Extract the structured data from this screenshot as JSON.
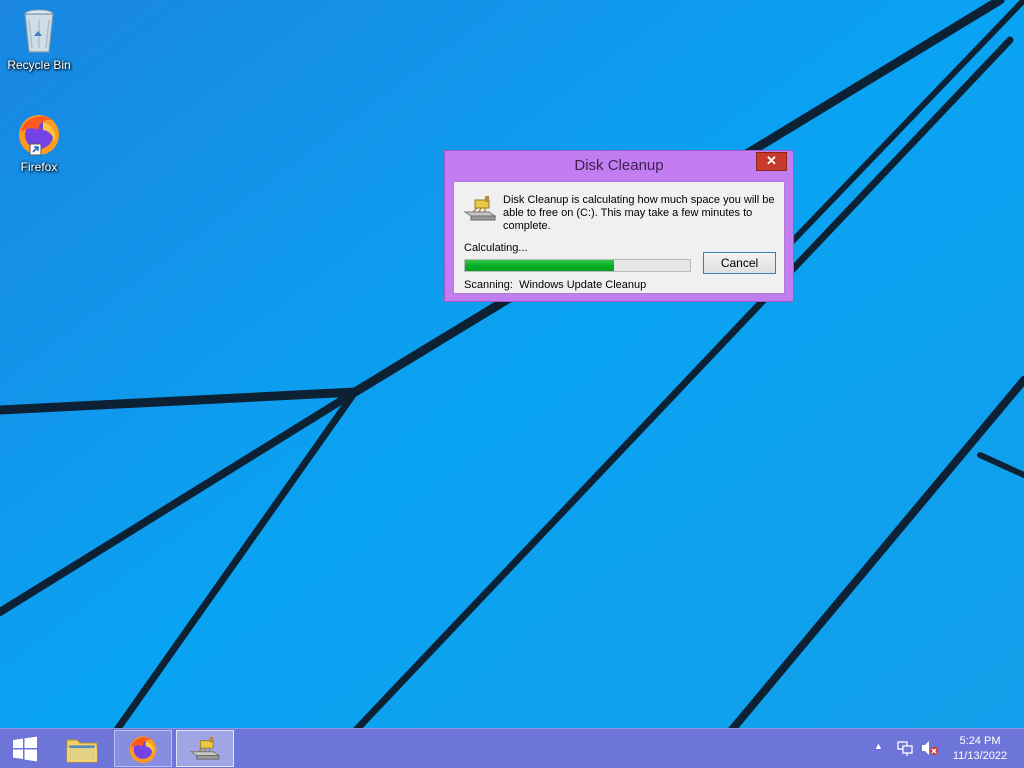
{
  "desktop": {
    "icons": [
      {
        "label": "Recycle Bin",
        "icon": "recycle-bin-icon"
      },
      {
        "label": "Firefox",
        "icon": "firefox-icon"
      }
    ]
  },
  "dialog": {
    "title": "Disk Cleanup",
    "close_glyph": "✕",
    "message": "Disk Cleanup is calculating how much space you will be able to free on  (C:). This may take a few minutes to complete.",
    "status_label": "Calculating...",
    "progress_fraction": 0.66,
    "progress_color": "#06b025",
    "cancel_label": "Cancel",
    "scanning_label": "Scanning:",
    "scanning_item": "Windows Update Cleanup"
  },
  "taskbar": {
    "items": [
      {
        "name": "start",
        "icon": "windows-logo-icon"
      },
      {
        "name": "file-explorer",
        "icon": "folder-icon"
      },
      {
        "name": "firefox",
        "icon": "firefox-icon"
      },
      {
        "name": "disk-cleanup",
        "icon": "disk-cleanup-icon"
      }
    ],
    "tray": {
      "chevron": "▲",
      "time": "5:24 PM",
      "date": "11/13/2022"
    }
  },
  "colors": {
    "dialog_frame": "#c27ef0",
    "taskbar": "#6d76d8",
    "close_button": "#c7392c"
  }
}
